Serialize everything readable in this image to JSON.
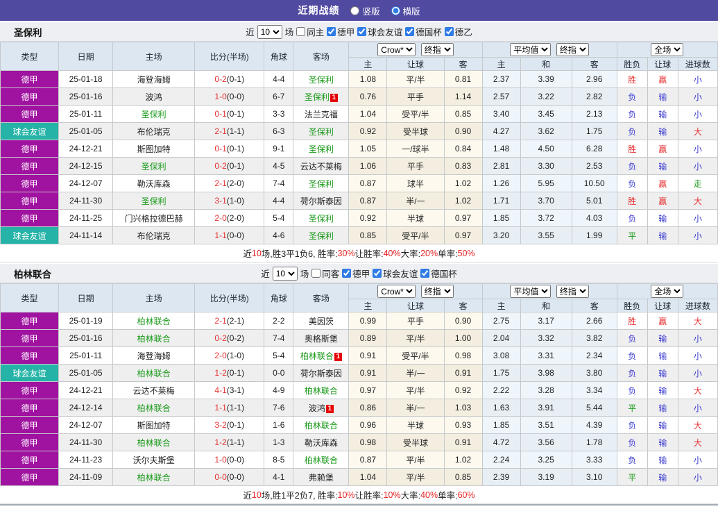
{
  "header": {
    "title": "近期战绩",
    "layout_options": [
      {
        "label": "竖版",
        "selected": false
      },
      {
        "label": "横版",
        "selected": true
      }
    ]
  },
  "columns": {
    "left": [
      "类型",
      "日期",
      "主场",
      "比分(半场)",
      "角球",
      "客场"
    ],
    "sub": [
      "主",
      "让球",
      "客",
      "主",
      "和",
      "客",
      "胜负",
      "让球",
      "进球数"
    ]
  },
  "selects": {
    "crow": "Crow*",
    "final": "终指",
    "avg": "平均值",
    "full": "全场"
  },
  "colors": {
    "topbar": "#514aa1",
    "league": {
      "德甲": "#a012a0",
      "球会友谊": "#26b3a7"
    },
    "focus_team": "#1a9a1a",
    "score_ft": "#e63232",
    "result": {
      "胜": "#e63232",
      "负": "#3a3ad0",
      "平": "#1a9a1a",
      "赢": "#e63232",
      "输": "#3a3ad0",
      "走": "#1a9a1a",
      "大": "#e63232",
      "小": "#3a3ad0"
    }
  },
  "sections": [
    {
      "team": "圣保利",
      "filter": {
        "prefix": "近",
        "count": "10",
        "suffix": "场",
        "same": {
          "label": "同主",
          "checked": false
        },
        "leagues": [
          {
            "label": "德甲",
            "checked": true
          },
          {
            "label": "球会友谊",
            "checked": true
          },
          {
            "label": "德国杯",
            "checked": true
          },
          {
            "label": "德乙",
            "checked": true
          }
        ]
      },
      "rows": [
        {
          "lg": "德甲",
          "dt": "25-01-18",
          "h": "海登海姆",
          "hf": 0,
          "hrc": "",
          "a": "圣保利",
          "af": 1,
          "arc": "",
          "ft": "0-2",
          "ht": "(0-1)",
          "cn": "4-4",
          "lt": [
            "1.08",
            "平/半",
            "0.81"
          ],
          "av": [
            "2.37",
            "3.39",
            "2.96"
          ],
          "rs": [
            "胜",
            "赢",
            "小"
          ]
        },
        {
          "lg": "德甲",
          "dt": "25-01-16",
          "h": "波鸿",
          "hf": 0,
          "hrc": "",
          "a": "圣保利",
          "af": 1,
          "arc": "1",
          "ft": "1-0",
          "ht": "(0-0)",
          "cn": "6-7",
          "lt": [
            "0.76",
            "平手",
            "1.14"
          ],
          "av": [
            "2.57",
            "3.22",
            "2.82"
          ],
          "rs": [
            "负",
            "输",
            "小"
          ]
        },
        {
          "lg": "德甲",
          "dt": "25-01-11",
          "h": "圣保利",
          "hf": 1,
          "hrc": "",
          "a": "法兰克福",
          "af": 0,
          "arc": "",
          "ft": "0-1",
          "ht": "(0-1)",
          "cn": "3-3",
          "lt": [
            "1.04",
            "受平/半",
            "0.85"
          ],
          "av": [
            "3.40",
            "3.45",
            "2.13"
          ],
          "rs": [
            "负",
            "输",
            "小"
          ]
        },
        {
          "lg": "球会友谊",
          "dt": "25-01-05",
          "h": "布伦瑞克",
          "hf": 0,
          "hrc": "",
          "a": "圣保利",
          "af": 1,
          "arc": "",
          "ft": "2-1",
          "ht": "(1-1)",
          "cn": "6-3",
          "lt": [
            "0.92",
            "受半球",
            "0.90"
          ],
          "av": [
            "4.27",
            "3.62",
            "1.75"
          ],
          "rs": [
            "负",
            "输",
            "大"
          ]
        },
        {
          "lg": "德甲",
          "dt": "24-12-21",
          "h": "斯图加特",
          "hf": 0,
          "hrc": "",
          "a": "圣保利",
          "af": 1,
          "arc": "",
          "ft": "0-1",
          "ht": "(0-1)",
          "cn": "9-1",
          "lt": [
            "1.05",
            "一/球半",
            "0.84"
          ],
          "av": [
            "1.48",
            "4.50",
            "6.28"
          ],
          "rs": [
            "胜",
            "赢",
            "小"
          ]
        },
        {
          "lg": "德甲",
          "dt": "24-12-15",
          "h": "圣保利",
          "hf": 1,
          "hrc": "",
          "a": "云达不莱梅",
          "af": 0,
          "arc": "",
          "ft": "0-2",
          "ht": "(0-1)",
          "cn": "4-5",
          "lt": [
            "1.06",
            "平手",
            "0.83"
          ],
          "av": [
            "2.81",
            "3.30",
            "2.53"
          ],
          "rs": [
            "负",
            "输",
            "小"
          ]
        },
        {
          "lg": "德甲",
          "dt": "24-12-07",
          "h": "勒沃库森",
          "hf": 0,
          "hrc": "",
          "a": "圣保利",
          "af": 1,
          "arc": "",
          "ft": "2-1",
          "ht": "(2-0)",
          "cn": "7-4",
          "lt": [
            "0.87",
            "球半",
            "1.02"
          ],
          "av": [
            "1.26",
            "5.95",
            "10.50"
          ],
          "rs": [
            "负",
            "赢",
            "走"
          ]
        },
        {
          "lg": "德甲",
          "dt": "24-11-30",
          "h": "圣保利",
          "hf": 1,
          "hrc": "",
          "a": "荷尔斯泰因",
          "af": 0,
          "arc": "",
          "ft": "3-1",
          "ht": "(1-0)",
          "cn": "4-4",
          "lt": [
            "0.87",
            "半/一",
            "1.02"
          ],
          "av": [
            "1.71",
            "3.70",
            "5.01"
          ],
          "rs": [
            "胜",
            "赢",
            "大"
          ]
        },
        {
          "lg": "德甲",
          "dt": "24-11-25",
          "h": "门兴格拉德巴赫",
          "hf": 0,
          "hrc": "",
          "a": "圣保利",
          "af": 1,
          "arc": "",
          "ft": "2-0",
          "ht": "(2-0)",
          "cn": "5-4",
          "lt": [
            "0.92",
            "半球",
            "0.97"
          ],
          "av": [
            "1.85",
            "3.72",
            "4.03"
          ],
          "rs": [
            "负",
            "输",
            "小"
          ]
        },
        {
          "lg": "球会友谊",
          "dt": "24-11-14",
          "h": "布伦瑞克",
          "hf": 0,
          "hrc": "",
          "a": "圣保利",
          "af": 1,
          "arc": "",
          "ft": "1-1",
          "ht": "(0-0)",
          "cn": "4-6",
          "lt": [
            "0.85",
            "受平/半",
            "0.97"
          ],
          "av": [
            "3.20",
            "3.55",
            "1.99"
          ],
          "rs": [
            "平",
            "输",
            "小"
          ]
        }
      ],
      "summary": [
        [
          "近",
          0
        ],
        [
          "10",
          1
        ],
        [
          "场,胜3平1负6, 胜率:",
          0
        ],
        [
          "30%",
          1
        ],
        [
          " 让胜率:",
          0
        ],
        [
          "40%",
          1
        ],
        [
          " 大率:",
          0
        ],
        [
          "20%",
          1
        ],
        [
          " 单率:",
          0
        ],
        [
          "50%",
          1
        ]
      ]
    },
    {
      "team": "柏林联合",
      "filter": {
        "prefix": "近",
        "count": "10",
        "suffix": "场",
        "same": {
          "label": "同客",
          "checked": false
        },
        "leagues": [
          {
            "label": "德甲",
            "checked": true
          },
          {
            "label": "球会友谊",
            "checked": true
          },
          {
            "label": "德国杯",
            "checked": true
          }
        ]
      },
      "rows": [
        {
          "lg": "德甲",
          "dt": "25-01-19",
          "h": "柏林联合",
          "hf": 1,
          "hrc": "",
          "a": "美因茨",
          "af": 0,
          "arc": "",
          "ft": "2-1",
          "ht": "(2-1)",
          "cn": "2-2",
          "lt": [
            "0.99",
            "平手",
            "0.90"
          ],
          "av": [
            "2.75",
            "3.17",
            "2.66"
          ],
          "rs": [
            "胜",
            "赢",
            "大"
          ]
        },
        {
          "lg": "德甲",
          "dt": "25-01-16",
          "h": "柏林联合",
          "hf": 1,
          "hrc": "",
          "a": "奥格斯堡",
          "af": 0,
          "arc": "",
          "ft": "0-2",
          "ht": "(0-2)",
          "cn": "7-4",
          "lt": [
            "0.89",
            "平/半",
            "1.00"
          ],
          "av": [
            "2.04",
            "3.32",
            "3.82"
          ],
          "rs": [
            "负",
            "输",
            "小"
          ]
        },
        {
          "lg": "德甲",
          "dt": "25-01-11",
          "h": "海登海姆",
          "hf": 0,
          "hrc": "",
          "a": "柏林联合",
          "af": 1,
          "arc": "1",
          "ft": "2-0",
          "ht": "(1-0)",
          "cn": "5-4",
          "lt": [
            "0.91",
            "受平/半",
            "0.98"
          ],
          "av": [
            "3.08",
            "3.31",
            "2.34"
          ],
          "rs": [
            "负",
            "输",
            "小"
          ]
        },
        {
          "lg": "球会友谊",
          "dt": "25-01-05",
          "h": "柏林联合",
          "hf": 1,
          "hrc": "",
          "a": "荷尔斯泰因",
          "af": 0,
          "arc": "",
          "ft": "1-2",
          "ht": "(0-1)",
          "cn": "0-0",
          "lt": [
            "0.91",
            "半/一",
            "0.91"
          ],
          "av": [
            "1.75",
            "3.98",
            "3.80"
          ],
          "rs": [
            "负",
            "输",
            "小"
          ]
        },
        {
          "lg": "德甲",
          "dt": "24-12-21",
          "h": "云达不莱梅",
          "hf": 0,
          "hrc": "",
          "a": "柏林联合",
          "af": 1,
          "arc": "",
          "ft": "4-1",
          "ht": "(3-1)",
          "cn": "4-9",
          "lt": [
            "0.97",
            "平/半",
            "0.92"
          ],
          "av": [
            "2.22",
            "3.28",
            "3.34"
          ],
          "rs": [
            "负",
            "输",
            "大"
          ]
        },
        {
          "lg": "德甲",
          "dt": "24-12-14",
          "h": "柏林联合",
          "hf": 1,
          "hrc": "",
          "a": "波鸿",
          "af": 0,
          "arc": "1",
          "ft": "1-1",
          "ht": "(1-1)",
          "cn": "7-6",
          "lt": [
            "0.86",
            "半/一",
            "1.03"
          ],
          "av": [
            "1.63",
            "3.91",
            "5.44"
          ],
          "rs": [
            "平",
            "输",
            "小"
          ]
        },
        {
          "lg": "德甲",
          "dt": "24-12-07",
          "h": "斯图加特",
          "hf": 0,
          "hrc": "",
          "a": "柏林联合",
          "af": 1,
          "arc": "",
          "ft": "3-2",
          "ht": "(0-1)",
          "cn": "1-6",
          "lt": [
            "0.96",
            "半球",
            "0.93"
          ],
          "av": [
            "1.85",
            "3.51",
            "4.39"
          ],
          "rs": [
            "负",
            "输",
            "大"
          ]
        },
        {
          "lg": "德甲",
          "dt": "24-11-30",
          "h": "柏林联合",
          "hf": 1,
          "hrc": "",
          "a": "勒沃库森",
          "af": 0,
          "arc": "",
          "ft": "1-2",
          "ht": "(1-1)",
          "cn": "1-3",
          "lt": [
            "0.98",
            "受半球",
            "0.91"
          ],
          "av": [
            "4.72",
            "3.56",
            "1.78"
          ],
          "rs": [
            "负",
            "输",
            "大"
          ]
        },
        {
          "lg": "德甲",
          "dt": "24-11-23",
          "h": "沃尔夫斯堡",
          "hf": 0,
          "hrc": "",
          "a": "柏林联合",
          "af": 1,
          "arc": "",
          "ft": "1-0",
          "ht": "(0-0)",
          "cn": "8-5",
          "lt": [
            "0.87",
            "平/半",
            "1.02"
          ],
          "av": [
            "2.24",
            "3.25",
            "3.33"
          ],
          "rs": [
            "负",
            "输",
            "小"
          ]
        },
        {
          "lg": "德甲",
          "dt": "24-11-09",
          "h": "柏林联合",
          "hf": 1,
          "hrc": "",
          "a": "弗赖堡",
          "af": 0,
          "arc": "",
          "ft": "0-0",
          "ht": "(0-0)",
          "cn": "4-1",
          "lt": [
            "1.04",
            "平/半",
            "0.85"
          ],
          "av": [
            "2.39",
            "3.19",
            "3.10"
          ],
          "rs": [
            "平",
            "输",
            "小"
          ]
        }
      ],
      "summary": [
        [
          "近",
          0
        ],
        [
          "10",
          1
        ],
        [
          "场,胜1平2负7, 胜率:",
          0
        ],
        [
          "10%",
          1
        ],
        [
          " 让胜率:",
          0
        ],
        [
          "10%",
          1
        ],
        [
          " 大率:",
          0
        ],
        [
          "40%",
          1
        ],
        [
          " 单率:",
          0
        ],
        [
          "60%",
          1
        ]
      ]
    }
  ]
}
